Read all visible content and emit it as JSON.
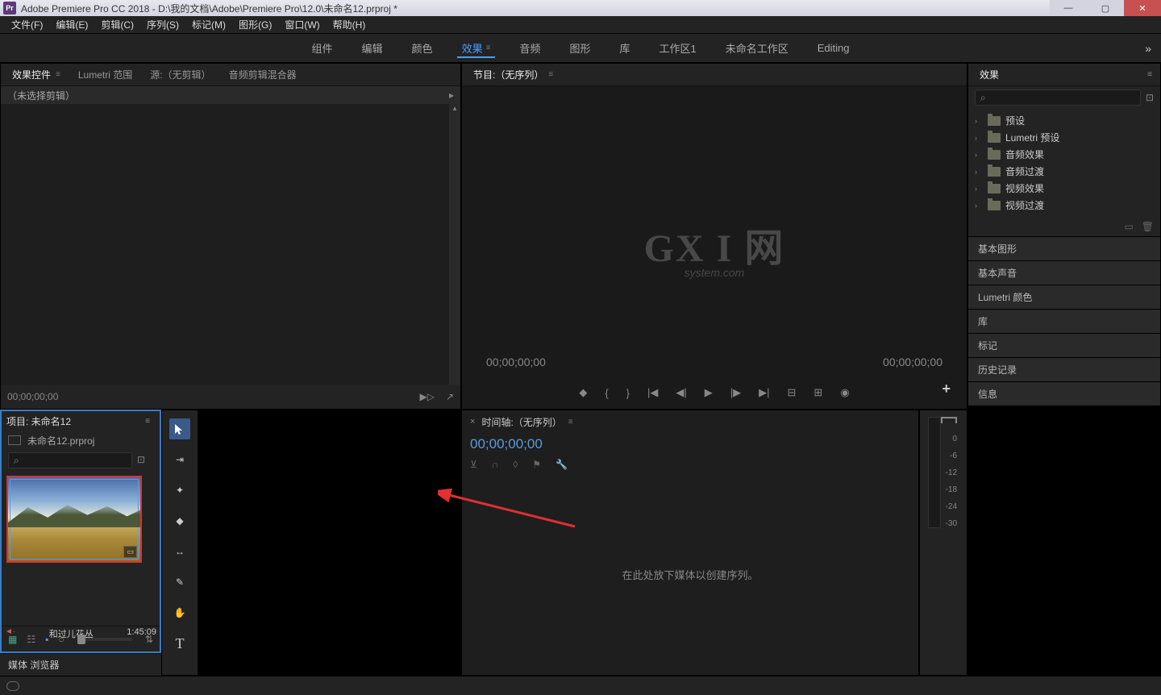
{
  "titlebar": {
    "app_icon_text": "Pr",
    "title": "Adobe Premiere Pro CC 2018 - D:\\我的文档\\Adobe\\Premiere Pro\\12.0\\未命名12.prproj *"
  },
  "menubar": {
    "items": [
      "文件(F)",
      "编辑(E)",
      "剪辑(C)",
      "序列(S)",
      "标记(M)",
      "图形(G)",
      "窗口(W)",
      "帮助(H)"
    ]
  },
  "workspace": {
    "tabs": [
      "组件",
      "编辑",
      "颜色",
      "效果",
      "音频",
      "图形",
      "库",
      "工作区1",
      "未命名工作区",
      "Editing"
    ],
    "active_index": 3,
    "overflow": "»"
  },
  "effect_controls": {
    "tabs": [
      "效果控件",
      "Lumetri 范围",
      "源:（无剪辑）",
      "音频剪辑混合器"
    ],
    "active_tab": 0,
    "header_text": "（未选择剪辑）",
    "timecode": "00;00;00;00"
  },
  "program_monitor": {
    "title": "节目:（无序列）",
    "tc_left": "00;00;00;00",
    "tc_right": "00;00;00;00",
    "watermark": "GX I 网",
    "watermark_sub": "system.com"
  },
  "project": {
    "title": "项目: 未命名12",
    "filename": "未命名12.prproj",
    "search_placeholder": "",
    "clip_name": "和过儿花丛",
    "clip_duration": "1:45:09",
    "media_browser": "媒体 浏览器"
  },
  "timeline": {
    "title": "时间轴:（无序列）",
    "timecode": "00;00;00;00",
    "empty_text": "在此处放下媒体以创建序列。"
  },
  "audio_meter": {
    "levels": [
      "0",
      "-6",
      "-12",
      "-18",
      "-24",
      "-30"
    ]
  },
  "effects_panel": {
    "title": "效果",
    "search_placeholder": "",
    "tree": [
      "预设",
      "Lumetri 预设",
      "音频效果",
      "音频过渡",
      "视频效果",
      "视频过渡"
    ]
  },
  "right_panels": [
    "基本图形",
    "基本声音",
    "Lumetri 颜色",
    "库",
    "标记",
    "历史记录",
    "信息"
  ],
  "icons": {
    "search": "⌕",
    "camera": "📷",
    "menu": "≡",
    "play": "▶",
    "step_back": "◀|",
    "step_fwd": "|▶",
    "goto_prev": "|◀",
    "goto_next": "▶|",
    "arrow_right": "▸",
    "chevron_right": "›"
  },
  "tools": [
    "select",
    "track-select",
    "ripple",
    "razor",
    "slip",
    "pen",
    "hand",
    "type"
  ]
}
